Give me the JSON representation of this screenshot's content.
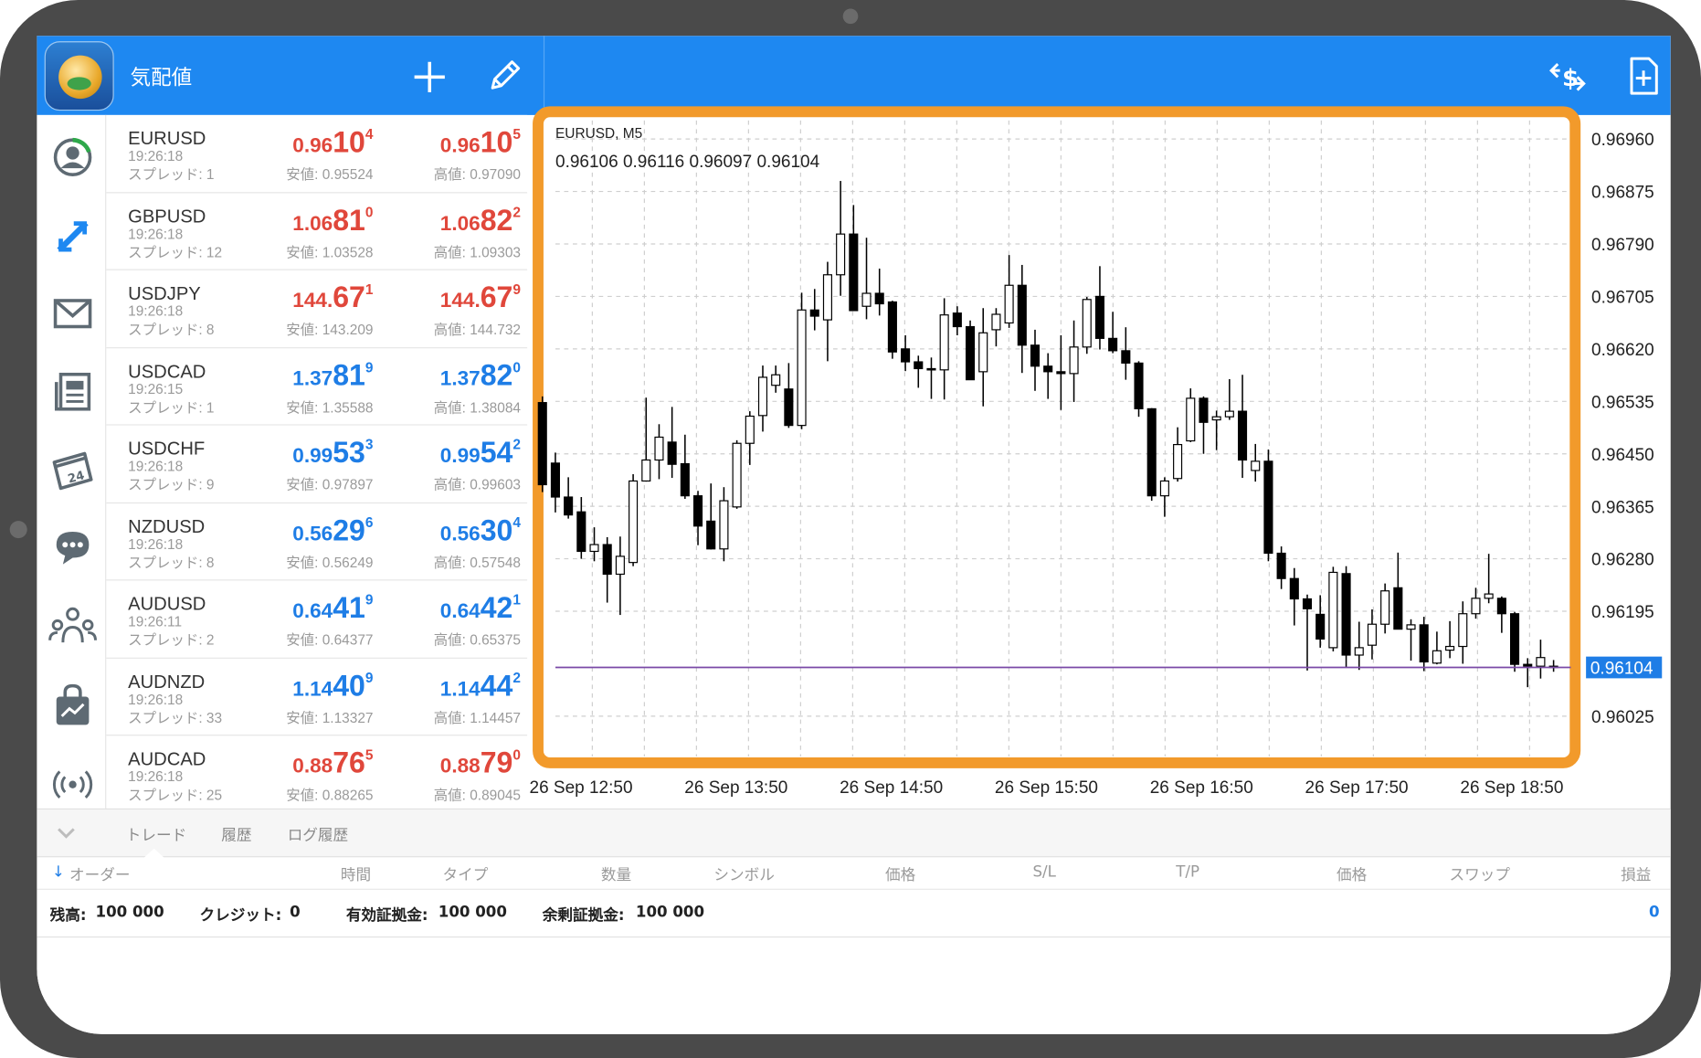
{
  "app": {
    "title": "気配値"
  },
  "quotes": [
    {
      "symbol": "EURUSD",
      "time": "19:26:18",
      "spread": "スプレッド: 1",
      "bid_a": "0.96",
      "bid_b": "10",
      "bid_c": "4",
      "ask_a": "0.96",
      "ask_b": "10",
      "ask_c": "5",
      "low": "安値: 0.95524",
      "high": "高値: 0.97090",
      "bid_color": "red",
      "ask_color": "red"
    },
    {
      "symbol": "GBPUSD",
      "time": "19:26:18",
      "spread": "スプレッド: 12",
      "bid_a": "1.06",
      "bid_b": "81",
      "bid_c": "0",
      "ask_a": "1.06",
      "ask_b": "82",
      "ask_c": "2",
      "low": "安値: 1.03528",
      "high": "高値: 1.09303",
      "bid_color": "red",
      "ask_color": "red"
    },
    {
      "symbol": "USDJPY",
      "time": "19:26:18",
      "spread": "スプレッド: 8",
      "bid_a": "144.",
      "bid_b": "67",
      "bid_c": "1",
      "ask_a": "144.",
      "ask_b": "67",
      "ask_c": "9",
      "low": "安値: 143.209",
      "high": "高値: 144.732",
      "bid_color": "red",
      "ask_color": "red"
    },
    {
      "symbol": "USDCAD",
      "time": "19:26:15",
      "spread": "スプレッド: 1",
      "bid_a": "1.37",
      "bid_b": "81",
      "bid_c": "9",
      "ask_a": "1.37",
      "ask_b": "82",
      "ask_c": "0",
      "low": "安値: 1.35588",
      "high": "高値: 1.38084",
      "bid_color": "blue",
      "ask_color": "blue"
    },
    {
      "symbol": "USDCHF",
      "time": "19:26:18",
      "spread": "スプレッド: 9",
      "bid_a": "0.99",
      "bid_b": "53",
      "bid_c": "3",
      "ask_a": "0.99",
      "ask_b": "54",
      "ask_c": "2",
      "low": "安値: 0.97897",
      "high": "高値: 0.99603",
      "bid_color": "blue",
      "ask_color": "blue"
    },
    {
      "symbol": "NZDUSD",
      "time": "19:26:18",
      "spread": "スプレッド: 8",
      "bid_a": "0.56",
      "bid_b": "29",
      "bid_c": "6",
      "ask_a": "0.56",
      "ask_b": "30",
      "ask_c": "4",
      "low": "安値: 0.56249",
      "high": "高値: 0.57548",
      "bid_color": "blue",
      "ask_color": "blue"
    },
    {
      "symbol": "AUDUSD",
      "time": "19:26:11",
      "spread": "スプレッド: 2",
      "bid_a": "0.64",
      "bid_b": "41",
      "bid_c": "9",
      "ask_a": "0.64",
      "ask_b": "42",
      "ask_c": "1",
      "low": "安値: 0.64377",
      "high": "高値: 0.65375",
      "bid_color": "blue",
      "ask_color": "blue"
    },
    {
      "symbol": "AUDNZD",
      "time": "19:26:18",
      "spread": "スプレッド: 33",
      "bid_a": "1.14",
      "bid_b": "40",
      "bid_c": "9",
      "ask_a": "1.14",
      "ask_b": "44",
      "ask_c": "2",
      "low": "安値: 1.13327",
      "high": "高値: 1.14457",
      "bid_color": "blue",
      "ask_color": "blue"
    },
    {
      "symbol": "AUDCAD",
      "time": "19:26:18",
      "spread": "スプレッド: 25",
      "bid_a": "0.88",
      "bid_b": "76",
      "bid_c": "5",
      "ask_a": "0.88",
      "ask_b": "79",
      "ask_c": "0",
      "low": "安値: 0.88265",
      "high": "高値: 0.89045",
      "bid_color": "red",
      "ask_color": "red"
    }
  ],
  "chart": {
    "symbol_tf": "EURUSD, M5",
    "ohlc": "0.96106 0.96116 0.96097 0.96104"
  },
  "chart_data": {
    "type": "candlestick",
    "y_ticks": [
      "0.96960",
      "0.96875",
      "0.96790",
      "0.96705",
      "0.96620",
      "0.96535",
      "0.96450",
      "0.96365",
      "0.96280",
      "0.96195",
      "0.96025"
    ],
    "y_range": [
      0.9596,
      0.9699
    ],
    "current_price": "0.96104",
    "current_price_value": 0.96104,
    "x_ticks": [
      "26 Sep 12:50",
      "26 Sep 13:50",
      "26 Sep 14:50",
      "26 Sep 15:50",
      "26 Sep 16:50",
      "26 Sep 17:50",
      "26 Sep 18:50"
    ],
    "candles": [
      [
        0.96533,
        0.96543,
        0.96388,
        0.964
      ],
      [
        0.96435,
        0.96452,
        0.96355,
        0.9638
      ],
      [
        0.9638,
        0.96412,
        0.96345,
        0.96351
      ],
      [
        0.96356,
        0.9638,
        0.9628,
        0.96292
      ],
      [
        0.96292,
        0.96331,
        0.96276,
        0.96303
      ],
      [
        0.96303,
        0.96315,
        0.96209,
        0.96255
      ],
      [
        0.96255,
        0.96316,
        0.96189,
        0.96284
      ],
      [
        0.96274,
        0.96417,
        0.96268,
        0.96406
      ],
      [
        0.96406,
        0.96541,
        0.96405,
        0.9644
      ],
      [
        0.9644,
        0.96498,
        0.96409,
        0.96477
      ],
      [
        0.96469,
        0.96526,
        0.96411,
        0.96433
      ],
      [
        0.96434,
        0.96481,
        0.96377,
        0.96382
      ],
      [
        0.96382,
        0.9639,
        0.96302,
        0.96333
      ],
      [
        0.96341,
        0.96402,
        0.96295,
        0.96296
      ],
      [
        0.96296,
        0.96396,
        0.96276,
        0.96374
      ],
      [
        0.96364,
        0.96472,
        0.96361,
        0.96467
      ],
      [
        0.96467,
        0.96519,
        0.96432,
        0.96511
      ],
      [
        0.96512,
        0.96593,
        0.96486,
        0.96574
      ],
      [
        0.96561,
        0.96593,
        0.96549,
        0.96578
      ],
      [
        0.96555,
        0.96597,
        0.96492,
        0.96496
      ],
      [
        0.96496,
        0.96711,
        0.9649,
        0.96683
      ],
      [
        0.96683,
        0.96717,
        0.9665,
        0.96673
      ],
      [
        0.96667,
        0.96761,
        0.966,
        0.9674
      ],
      [
        0.9674,
        0.96892,
        0.96706,
        0.96806
      ],
      [
        0.96806,
        0.96853,
        0.96692,
        0.96682
      ],
      [
        0.96689,
        0.968,
        0.96668,
        0.9671
      ],
      [
        0.9671,
        0.9675,
        0.96674,
        0.96693
      ],
      [
        0.96696,
        0.96698,
        0.96604,
        0.96615
      ],
      [
        0.9662,
        0.96642,
        0.96584,
        0.96599
      ],
      [
        0.96599,
        0.96609,
        0.96557,
        0.96588
      ],
      [
        0.96588,
        0.96606,
        0.96539,
        0.96586
      ],
      [
        0.96586,
        0.96702,
        0.96538,
        0.96675
      ],
      [
        0.96678,
        0.96689,
        0.96642,
        0.96656
      ],
      [
        0.96656,
        0.96666,
        0.9657,
        0.9657
      ],
      [
        0.96583,
        0.96686,
        0.96527,
        0.96646
      ],
      [
        0.96651,
        0.96686,
        0.96624,
        0.96676
      ],
      [
        0.96662,
        0.96772,
        0.96654,
        0.96723
      ],
      [
        0.96723,
        0.96756,
        0.96581,
        0.96626
      ],
      [
        0.96626,
        0.96651,
        0.96552,
        0.96592
      ],
      [
        0.96592,
        0.96613,
        0.96539,
        0.96583
      ],
      [
        0.96583,
        0.96642,
        0.96521,
        0.9658
      ],
      [
        0.9658,
        0.96666,
        0.96534,
        0.96623
      ],
      [
        0.96623,
        0.96704,
        0.96612,
        0.967
      ],
      [
        0.96705,
        0.96754,
        0.96619,
        0.96637
      ],
      [
        0.96637,
        0.9668,
        0.96613,
        0.96617
      ],
      [
        0.96617,
        0.96655,
        0.9657,
        0.96597
      ],
      [
        0.96597,
        0.966,
        0.9651,
        0.96523
      ],
      [
        0.96523,
        0.96524,
        0.96374,
        0.96382
      ],
      [
        0.96382,
        0.96412,
        0.96348,
        0.96406
      ],
      [
        0.9641,
        0.96493,
        0.96405,
        0.96465
      ],
      [
        0.96471,
        0.96556,
        0.96469,
        0.9654
      ],
      [
        0.9654,
        0.96543,
        0.9645,
        0.96501
      ],
      [
        0.96505,
        0.9652,
        0.96456,
        0.9651
      ],
      [
        0.9651,
        0.96571,
        0.96505,
        0.96519
      ],
      [
        0.96519,
        0.96578,
        0.96411,
        0.9644
      ],
      [
        0.96423,
        0.96466,
        0.96405,
        0.96438
      ],
      [
        0.96438,
        0.96457,
        0.96276,
        0.96289
      ],
      [
        0.96289,
        0.963,
        0.96231,
        0.96248
      ],
      [
        0.96248,
        0.96265,
        0.96172,
        0.96215
      ],
      [
        0.96215,
        0.96222,
        0.96099,
        0.96199
      ],
      [
        0.9619,
        0.96221,
        0.96136,
        0.9615
      ],
      [
        0.96136,
        0.96267,
        0.9613,
        0.96258
      ],
      [
        0.96256,
        0.96268,
        0.96104,
        0.96124
      ],
      [
        0.96124,
        0.96178,
        0.961,
        0.96136
      ],
      [
        0.9614,
        0.96198,
        0.96117,
        0.96174
      ],
      [
        0.96174,
        0.9624,
        0.96159,
        0.96228
      ],
      [
        0.96233,
        0.9629,
        0.9617,
        0.96166
      ],
      [
        0.96166,
        0.96182,
        0.96115,
        0.96173
      ],
      [
        0.96173,
        0.96186,
        0.96098,
        0.96113
      ],
      [
        0.96111,
        0.96162,
        0.96109,
        0.96131
      ],
      [
        0.96132,
        0.96179,
        0.96119,
        0.96138
      ],
      [
        0.96138,
        0.96211,
        0.9611,
        0.96191
      ],
      [
        0.96191,
        0.96233,
        0.96183,
        0.96216
      ],
      [
        0.96216,
        0.96288,
        0.96208,
        0.96223
      ],
      [
        0.96216,
        0.96219,
        0.9616,
        0.96191
      ],
      [
        0.96191,
        0.96194,
        0.96097,
        0.96109
      ],
      [
        0.96109,
        0.96119,
        0.96072,
        0.96106
      ],
      [
        0.96106,
        0.96149,
        0.96086,
        0.9612
      ],
      [
        0.96106,
        0.96116,
        0.96097,
        0.96104
      ]
    ]
  },
  "bottom": {
    "tabs": [
      "トレード",
      "履歴",
      "ログ履歴"
    ],
    "columns": [
      "オーダー",
      "時間",
      "タイプ",
      "数量",
      "シンボル",
      "価格",
      "S/L",
      "T/P",
      "価格",
      "スワップ",
      "損益"
    ],
    "balance_label": "残高: ",
    "balance": "100 000",
    "credit_label": "クレジット: ",
    "credit": "0",
    "equity_label": "有効証拠金: ",
    "equity": "100 000",
    "free_margin_label": "余剰証拠金: ",
    "free_margin": "100 000",
    "profit": "0"
  }
}
